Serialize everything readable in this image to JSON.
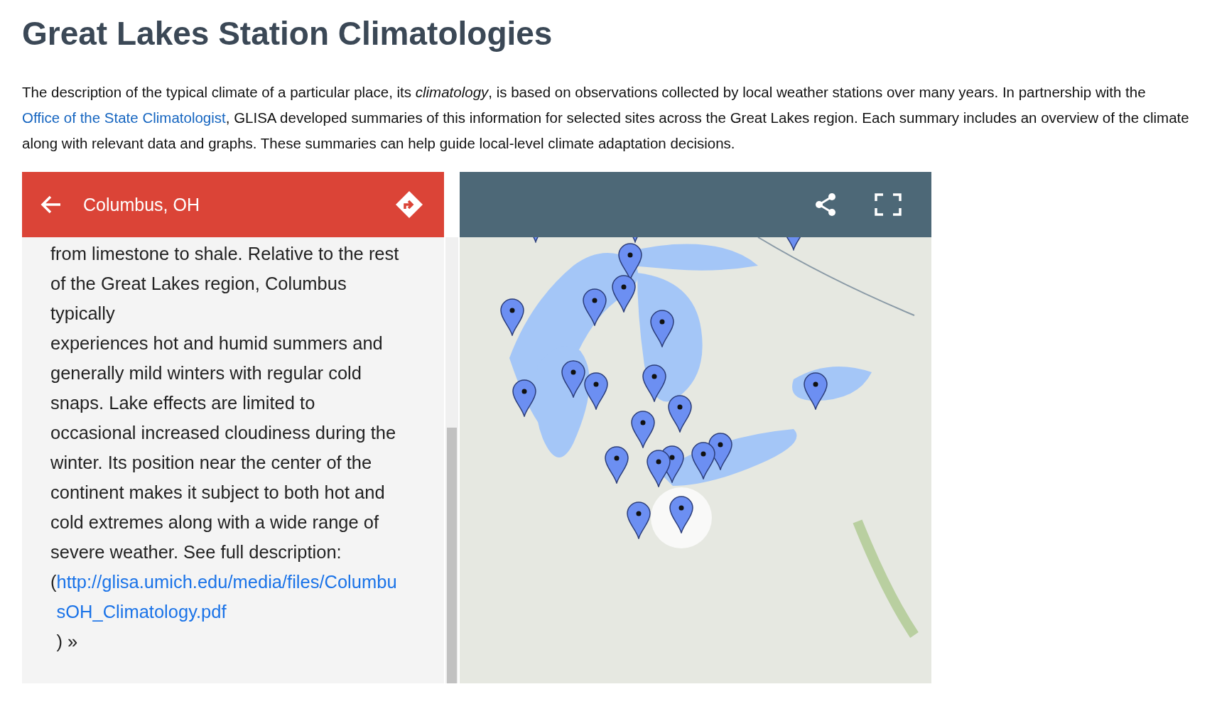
{
  "title": "Great Lakes Station Climatologies",
  "intro": {
    "before": "The description of the typical climate of a particular place, its *climatology*, is based on observations collected by local weather stations over many years. In partnership with the ",
    "link": "Office of the State Climatologist",
    "after": ", GLISA developed summaries of this information for selected sites across the Great Lakes region. Each summary includes an overview of the climate along with relevant data and graphs. These summaries can help guide local-level climate adaptation decisions."
  },
  "panel": {
    "title": "Columbus, OH",
    "description": [
      "from limestone to shale. Relative to the rest of the Great Lakes region, Columbus typically",
      "experiences hot and humid summers and generally mild winters with regular cold snaps. Lake effects are limited to occasional increased cloudiness during the winter. Its position near the center of the continent makes it subject to both hot and cold extremes along with a wide range of severe weather. See full description:"
    ],
    "link_open": "(",
    "link": "http://glisa.umich.edu/media/files/ColumbusOH_Climatology.pdf",
    "link_close": ") »"
  }
}
